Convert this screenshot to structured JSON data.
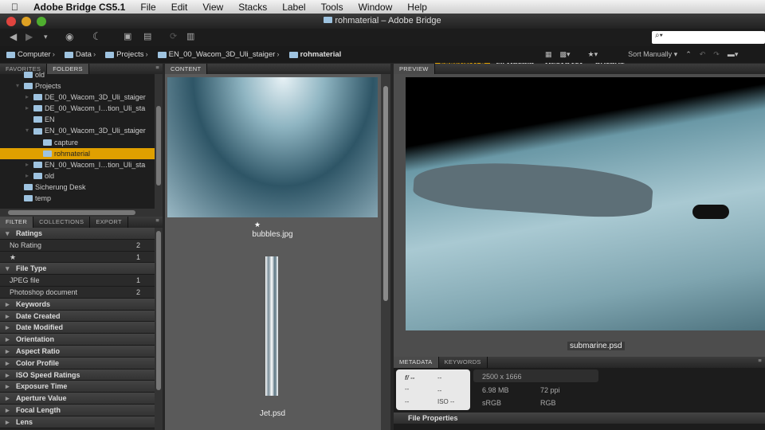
{
  "menubar": {
    "app": "Adobe Bridge CS5.1",
    "items": [
      "File",
      "Edit",
      "View",
      "Stacks",
      "Label",
      "Tools",
      "Window",
      "Help"
    ]
  },
  "window": {
    "title": "rohmaterial – Adobe Bridge"
  },
  "workspaces": {
    "items": [
      "ESSENTIALS",
      "FILMSTRIP",
      "METADATA",
      "OUTPUT"
    ],
    "active": "ESSENTIALS",
    "accent": "#e0a000"
  },
  "search": {
    "placeholder": ""
  },
  "sort": {
    "label": "Sort Manually"
  },
  "path": [
    "Computer",
    "Data",
    "Projects",
    "EN_00_Wacom_3D_Uli_staiger",
    "rohmaterial"
  ],
  "left_tabs": [
    "FAVORITES",
    "FOLDERS"
  ],
  "folders": [
    {
      "label": "old",
      "depth": 2,
      "arrow": ""
    },
    {
      "label": "Projects",
      "depth": 2,
      "arrow": "▾"
    },
    {
      "label": "DE_00_Wacom_3D_Uli_staiger",
      "depth": 3,
      "arrow": "▸"
    },
    {
      "label": "DE_00_Wacom_I…tion_Uli_sta",
      "depth": 3,
      "arrow": "▸"
    },
    {
      "label": "EN",
      "depth": 3,
      "arrow": ""
    },
    {
      "label": "EN_00_Wacom_3D_Uli_staiger",
      "depth": 3,
      "arrow": "▾"
    },
    {
      "label": "capture",
      "depth": 4,
      "arrow": ""
    },
    {
      "label": "rohmaterial",
      "depth": 4,
      "arrow": "",
      "selected": true
    },
    {
      "label": "EN_00_Wacom_I…tion_Uli_sta",
      "depth": 3,
      "arrow": "▸"
    },
    {
      "label": "old",
      "depth": 3,
      "arrow": "▸"
    },
    {
      "label": "Sicherung Desk",
      "depth": 2,
      "arrow": ""
    },
    {
      "label": "temp",
      "depth": 2,
      "arrow": ""
    }
  ],
  "filter_tabs": [
    "FILTER",
    "COLLECTIONS",
    "EXPORT"
  ],
  "filter": [
    {
      "label": "Ratings",
      "type": "head",
      "open": true
    },
    {
      "label": "No Rating",
      "count": "2"
    },
    {
      "label": "★",
      "count": "1"
    },
    {
      "label": "File Type",
      "type": "head",
      "open": true
    },
    {
      "label": "JPEG file",
      "count": "1"
    },
    {
      "label": "Photoshop document",
      "count": "2"
    },
    {
      "label": "Keywords",
      "type": "head"
    },
    {
      "label": "Date Created",
      "type": "head"
    },
    {
      "label": "Date Modified",
      "type": "head"
    },
    {
      "label": "Orientation",
      "type": "head"
    },
    {
      "label": "Aspect Ratio",
      "type": "head"
    },
    {
      "label": "Color Profile",
      "type": "head"
    },
    {
      "label": "ISO Speed Ratings",
      "type": "head"
    },
    {
      "label": "Exposure Time",
      "type": "head"
    },
    {
      "label": "Aperture Value",
      "type": "head"
    },
    {
      "label": "Focal Length",
      "type": "head"
    },
    {
      "label": "Lens",
      "type": "head"
    }
  ],
  "content": {
    "tab": "CONTENT",
    "items": [
      {
        "name": "bubbles.jpg",
        "rating": "★"
      },
      {
        "name": "Jet.psd",
        "rating": ""
      }
    ]
  },
  "preview": {
    "tab": "PREVIEW",
    "filename": "submarine.psd"
  },
  "metadata": {
    "tabs": [
      "METADATA",
      "KEYWORDS"
    ],
    "camera": {
      "aperture": "f/ --",
      "shutter": "--",
      "c1": "--",
      "c2": "--",
      "c3": "--",
      "iso": "ISO --"
    },
    "dimensions": "2500 x 1666",
    "size": "6.98 MB",
    "resolution": "72 ppi",
    "profile": "sRGB",
    "mode": "RGB",
    "section": "File Properties"
  }
}
